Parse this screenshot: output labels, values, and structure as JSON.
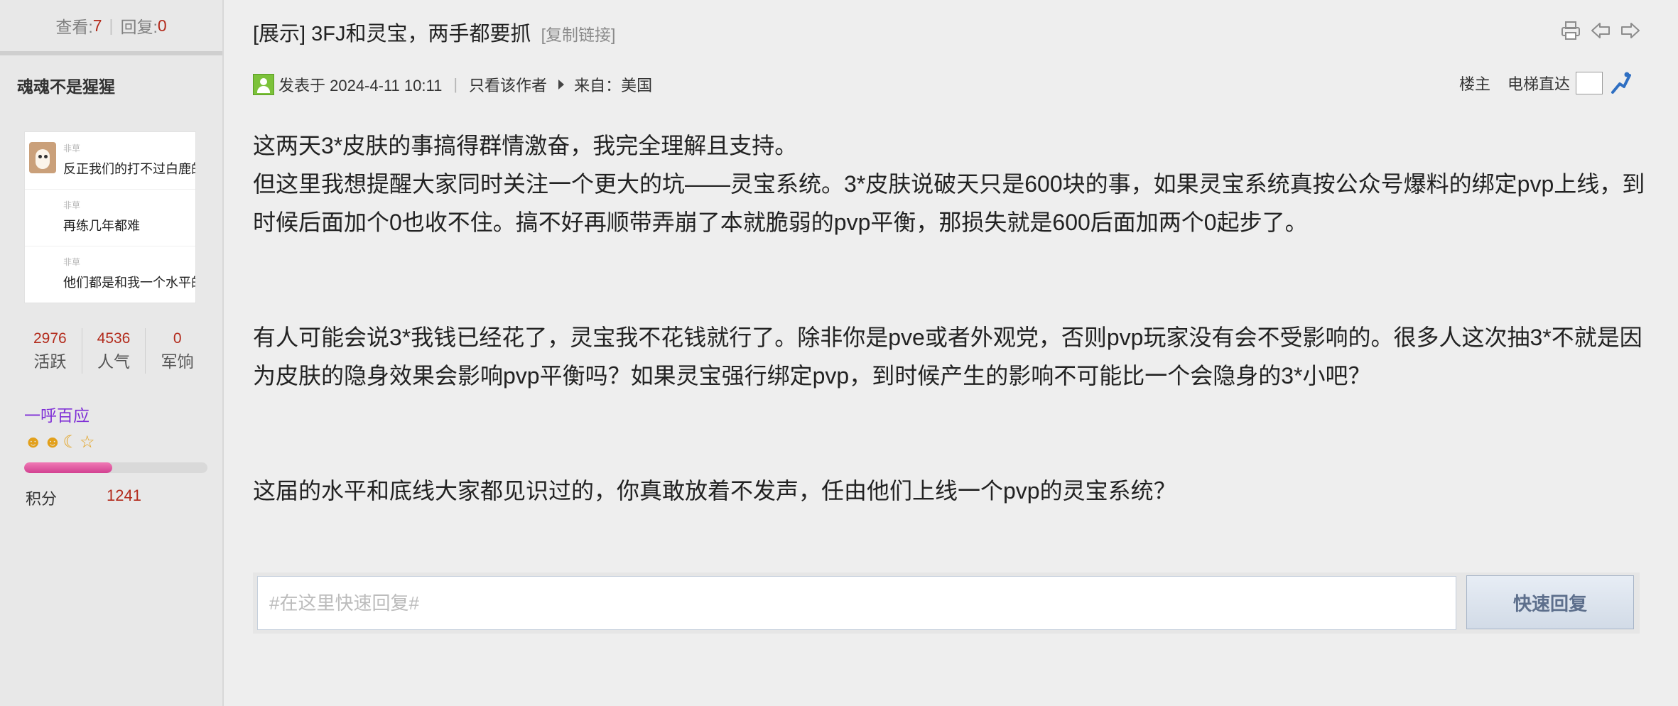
{
  "sidebar": {
    "views_label": "查看:",
    "views": "7",
    "replies_label": "回复:",
    "replies": "0",
    "author_name": "魂魂不是猩猩",
    "avatar_chat": [
      {
        "name": "非草",
        "text": "反正我们的打不过白鹿的"
      },
      {
        "name": "非草",
        "text": "再练几年都难"
      },
      {
        "name": "非草",
        "text": "他们都是和我一个水平的"
      }
    ],
    "user_stats": [
      {
        "value": "2976",
        "label": "活跃"
      },
      {
        "value": "4536",
        "label": "人气"
      },
      {
        "value": "0",
        "label": "军饷"
      }
    ],
    "user_group": "一呼百应",
    "level_icons": [
      "sun-icon",
      "sun-icon",
      "moon-icon",
      "star-icon"
    ],
    "level_progress": 0.48,
    "score_label": "积分",
    "score_value": "1241"
  },
  "thread": {
    "title": "[展示] 3FJ和灵宝，两手都要抓",
    "copy_link": "[复制链接]",
    "tools": [
      "print-icon",
      "prev-thread-icon",
      "next-thread-icon"
    ]
  },
  "post": {
    "posted_at": "发表于 2024-4-11 10:11",
    "only_author": "只看该作者",
    "from": "来自：美国",
    "floor_label": "楼主",
    "elevator_label": "电梯直达",
    "paragraphs": [
      "这两天3*皮肤的事搞得群情激奋，我完全理解且支持。",
      "但这里我想提醒大家同时关注一个更大的坑——灵宝系统。3*皮肤说破天只是600块的事，如果灵宝系统真按公众号爆料的绑定pvp上线，到时候后面加个0也收不住。搞不好再顺带弄崩了本就脆弱的pvp平衡，那损失就是600后面加两个0起步了。",
      "有人可能会说3*我钱已经花了，灵宝我不花钱就行了。除非你是pve或者外观党，否则pvp玩家没有会不受影响的。很多人这次抽3*不就是因为皮肤的隐身效果会影响pvp平衡吗？如果灵宝强行绑定pvp，到时候产生的影响不可能比一个会隐身的3*小吧？",
      "这届的水平和底线大家都见识过的，你真敢放着不发声，任由他们上线一个pvp的灵宝系统？"
    ]
  },
  "reply": {
    "placeholder": "#在这里快速回复#",
    "button": "快速回复"
  },
  "colors": {
    "accent_red": "#b32b1c",
    "group_purple": "#7f2fd6",
    "level_pink": "#d24191"
  }
}
